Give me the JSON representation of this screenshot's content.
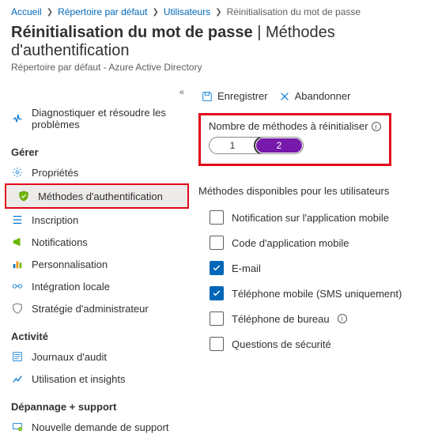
{
  "breadcrumb": {
    "home": "Accueil",
    "dir": "Répertoire par défaut",
    "users": "Utilisateurs",
    "current": "Réinitialisation du mot de passe"
  },
  "header": {
    "title": "Réinitialisation du mot de passe",
    "section": "Méthodes d'authentification",
    "subtitle": "Répertoire par défaut - Azure Active Directory"
  },
  "toolbar": {
    "save": "Enregistrer",
    "discard": "Abandonner"
  },
  "sidebar": {
    "diagnose": "Diagnostiquer et résoudre les problèmes",
    "group_manage": "Gérer",
    "properties": "Propriétés",
    "auth_methods": "Méthodes d'authentification",
    "registration": "Inscription",
    "notifications": "Notifications",
    "customization": "Personnalisation",
    "onprem": "Intégration locale",
    "admin_policy": "Stratégie d'administrateur",
    "group_activity": "Activité",
    "audit_logs": "Journaux d'audit",
    "usage_insights": "Utilisation et insights",
    "group_support": "Dépannage + support",
    "new_request": "Nouvelle demande de support"
  },
  "methods_reset": {
    "label": "Nombre de méthodes à réinitialiser",
    "opt1": "1",
    "opt2": "2"
  },
  "available": {
    "title": "Méthodes disponibles pour les utilisateurs",
    "mobile_app_notif": "Notification sur l'application mobile",
    "mobile_app_code": "Code d'application mobile",
    "email": "E-mail",
    "mobile_phone": "Téléphone mobile (SMS uniquement)",
    "office_phone": "Téléphone de bureau",
    "security_q": "Questions de sécurité"
  }
}
